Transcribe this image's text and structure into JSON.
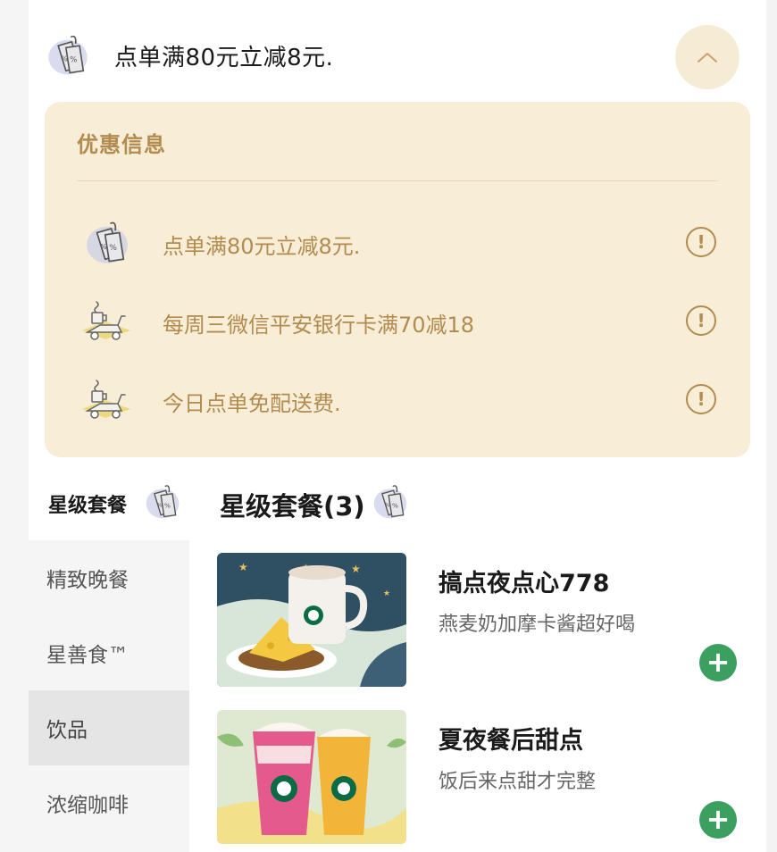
{
  "promo_header": {
    "title": "点单满80元立减8元.",
    "icon": "discount-tag-icon",
    "collapse_icon": "chevron-up-icon"
  },
  "promo_panel": {
    "title": "优惠信息",
    "items": [
      {
        "text": "点单满80元立减8元.",
        "icon": "discount-tag-icon",
        "info": "!"
      },
      {
        "text": "每周三微信平安银行卡满70减18",
        "icon": "delivery-scooter-icon",
        "info": "!"
      },
      {
        "text": "今日点单免配送费.",
        "icon": "delivery-scooter-icon",
        "info": "!"
      }
    ]
  },
  "sidebar": {
    "current_category": "星级套餐",
    "items": [
      {
        "label": "精致晚餐"
      },
      {
        "label": "星善食™"
      },
      {
        "label": "饮品",
        "active": true
      },
      {
        "label": "浓缩咖啡"
      }
    ]
  },
  "section": {
    "title": "星级套餐(3)"
  },
  "products": [
    {
      "name": "搞点夜点心778",
      "desc": "燕麦奶加摩卡酱超好喝",
      "add": "+"
    },
    {
      "name": "夏夜餐后甜点",
      "desc": "饭后来点甜才完整",
      "add": "+"
    }
  ],
  "colors": {
    "accent_gold": "#b28b4f",
    "panel_bg": "#f8edd7",
    "add_green": "#3b9f5f"
  }
}
